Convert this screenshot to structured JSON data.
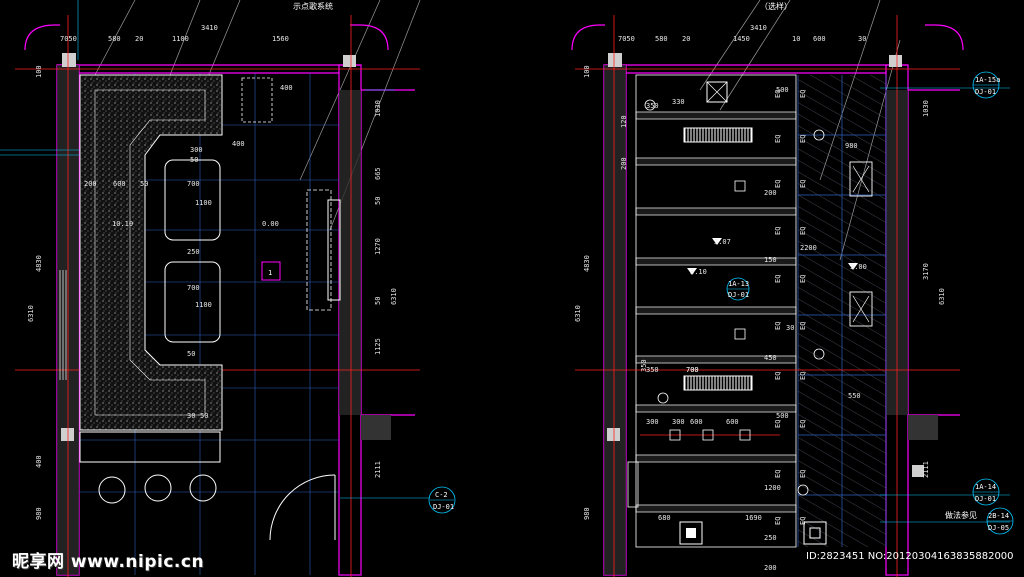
{
  "left_plan": {
    "title_fragment": "示点歌系统",
    "top_dims": [
      "7050",
      "580",
      "20",
      "1100",
      "1560"
    ],
    "overall_width": "3410",
    "left_dims": [
      "100",
      "4830",
      "6310",
      "400",
      "980"
    ],
    "right_dims": [
      "1030",
      "665",
      "50",
      "1270",
      "50",
      "1125",
      "2111",
      "6310"
    ],
    "inner_dims": [
      "400",
      "400",
      "300",
      "50",
      "200",
      "600",
      "50",
      "700",
      "1100",
      "250",
      "700",
      "1100",
      "50",
      "30",
      "50"
    ],
    "level": "0.00",
    "sofa_level": "10.10",
    "room_no": "1",
    "callout": {
      "line1": "C-2",
      "line2": "DJ-01"
    }
  },
  "right_plan": {
    "title_fragment": "（选样）",
    "top_dims": [
      "7050",
      "580",
      "20",
      "1450",
      "10",
      "600",
      "30"
    ],
    "overall_width": "3410",
    "left_dims": [
      "100",
      "4830",
      "6310",
      "350",
      "120",
      "200",
      "980"
    ],
    "right_dims": [
      "1030",
      "3170",
      "6310",
      "2111"
    ],
    "inner_dims": [
      "350",
      "330",
      "500",
      "700",
      "200",
      "150",
      "450",
      "30",
      "500",
      "1200",
      "250",
      "200",
      "680",
      "1690",
      "300",
      "300",
      "600",
      "600",
      "700",
      "350",
      "980",
      "2200",
      "550"
    ],
    "eq_label": "EQ",
    "levels": [
      "3.07",
      "3.10",
      "3.00"
    ],
    "callouts": [
      {
        "line1": "1A-15a",
        "line2": "DJ-01"
      },
      {
        "line1": "1A-13",
        "line2": "DJ-01"
      },
      {
        "line1": "1A-14",
        "line2": "DJ-01"
      },
      {
        "line1": "2B-14",
        "line2": "DJ-05"
      }
    ],
    "note": "做法参见"
  },
  "watermark": {
    "brand": "昵享网 www.nipic.cn",
    "id_line": "ID:2823451 NO:20120304163835882000"
  },
  "colors": {
    "wall": "#ff00ff",
    "axis": "#ff2020",
    "dim": "#00c8ff",
    "white": "#e8e8e8",
    "grey": "#9a9a9a",
    "hatch": "#8a8aa0"
  }
}
